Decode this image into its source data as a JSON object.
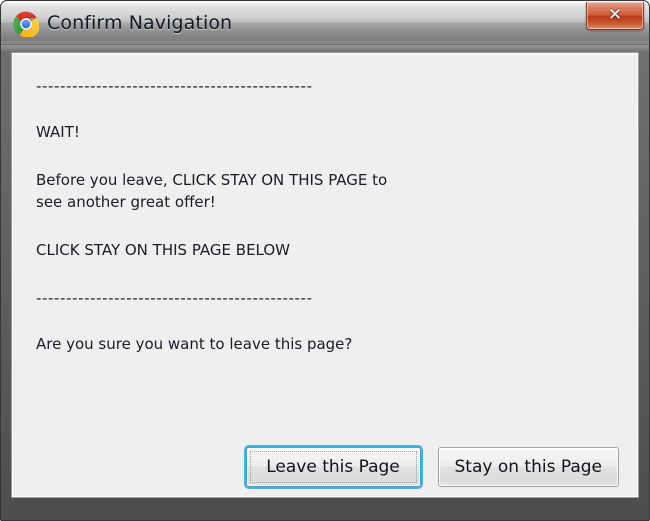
{
  "window": {
    "title": "Confirm Navigation",
    "icon": "chrome-logo-icon",
    "close_label": "✕",
    "close_icon": "close-icon",
    "frame_color": "#4d4d4d",
    "titlebar_color": "#bcbcbc",
    "close_button_color": "#bc3b18",
    "client_background": "#efefef"
  },
  "dialog": {
    "rule_top": "----------------------------------------------",
    "line_wait": "WAIT!",
    "line_before_leave": "Before you leave, CLICK STAY ON THIS PAGE to\nsee another great offer!",
    "line_click_below": "CLICK STAY ON THIS PAGE BELOW",
    "rule_bottom": "----------------------------------------------",
    "line_confirm": "Are you sure you want to leave this page?",
    "text_color": "#1b1b2a"
  },
  "buttons": {
    "leave": {
      "label": "Leave this Page",
      "focused": true,
      "focus_color": "#49b2e4"
    },
    "stay": {
      "label": "Stay on this Page",
      "focused": false
    }
  }
}
